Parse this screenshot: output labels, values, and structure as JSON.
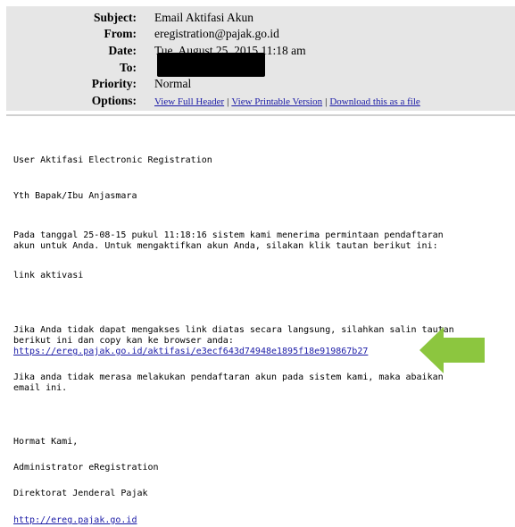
{
  "header": {
    "subject_label": "Subject:",
    "subject_value": "Email Aktifasi Akun",
    "from_label": "From:",
    "from_value": "eregistration@pajak.go.id",
    "date_label": "Date:",
    "date_value": "Tue, August 25, 2015 11:18 am",
    "to_label": "To:",
    "priority_label": "Priority:",
    "priority_value": "Normal",
    "options_label": "Options:",
    "options": [
      "View Full Header",
      "View Printable Version",
      "Download this as a file"
    ],
    "separator": "|"
  },
  "body": {
    "line_title": "User Aktifasi Electronic Registration",
    "line_greeting": "Yth Bapak/Ibu Anjasmara",
    "para1_line1": "Pada tanggal 25-08-15 pukul 11:18:16 sistem kami menerima permintaan pendaftaran",
    "para1_line2": "akun untuk Anda. Untuk mengaktifkan akun Anda, silakan klik tautan berikut ini:",
    "link_activation_text": "link aktivasi",
    "para2_line1": "Jika Anda tidak dapat mengakses link diatas secara langsung, silahkan salin tautan",
    "para2_line2": "berikut ini dan copy kan ke browser anda:",
    "activation_url": "https://ereg.pajak.go.id/aktifasi/e3ecf643d74948e1895f18e919867b27",
    "para3_line1": "Jika anda tidak merasa melakukan pendaftaran akun pada sistem kami, maka abaikan",
    "para3_line2": "email ini.",
    "closing": "Hormat Kami,",
    "signature_role": "Administrator eRegistration",
    "signature_org": "Direktorat Jenderal Pajak",
    "site_url": "http://ereg.pajak.go.id"
  },
  "colors": {
    "header_bg": "#e6e6e6",
    "link": "#1a1aa6",
    "arrow": "#8cc63f"
  },
  "icons": {
    "arrow": "arrow-left-icon"
  }
}
